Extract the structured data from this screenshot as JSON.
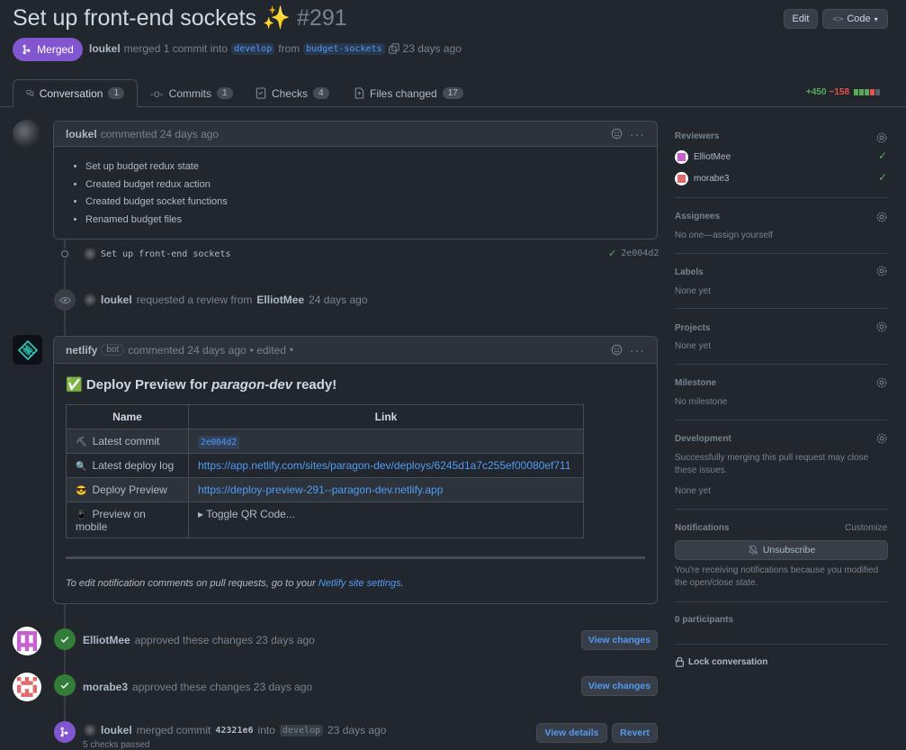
{
  "header": {
    "title": "Set up front-end sockets ✨",
    "number": "#291",
    "edit_label": "Edit",
    "code_label": "Code",
    "status_label": "Merged",
    "author": "loukel",
    "merged_text": "merged 1 commit into",
    "base_branch": "develop",
    "from_text": "from",
    "head_branch": "budget-sockets",
    "time": "23 days ago"
  },
  "tabs": [
    {
      "label": "Conversation",
      "count": "1"
    },
    {
      "label": "Commits",
      "count": "1"
    },
    {
      "label": "Checks",
      "count": "4"
    },
    {
      "label": "Files changed",
      "count": "17"
    }
  ],
  "diffstat": {
    "additions": "+450",
    "deletions": "−158"
  },
  "first_comment": {
    "author": "loukel",
    "meta": "commented 24 days ago",
    "items": [
      "Set up budget redux state",
      "Created budget redux action",
      "Created budget socket functions",
      "Renamed budget files"
    ]
  },
  "commit_event": {
    "message": "Set up front-end sockets",
    "sha": "2e004d2"
  },
  "review_request": {
    "author": "loukel",
    "text": "requested a review from",
    "reviewer": "ElliotMee",
    "time": "24 days ago"
  },
  "bot_comment": {
    "author": "netlify",
    "badge": "bot",
    "meta": "commented 24 days ago",
    "edited": "• edited",
    "heading_prefix": "✅ Deploy Preview for",
    "heading_site": "paragon-dev",
    "heading_suffix": "ready!",
    "table_headers": [
      "Name",
      "Link"
    ],
    "rows": [
      {
        "icon": "⛏",
        "name": "Latest commit",
        "value": "2e004d2"
      },
      {
        "icon": "🔍",
        "name": "Latest deploy log",
        "value": "https://app.netlify.com/sites/paragon-dev/deploys/6245d1a7c255ef00080ef711"
      },
      {
        "icon": "😎",
        "name": "Deploy Preview",
        "value": "https://deploy-preview-291--paragon-dev.netlify.app"
      },
      {
        "icon": "📱",
        "name": "Preview on mobile",
        "value": "▸  Toggle QR Code..."
      }
    ],
    "footer_prefix": "To edit notification comments on pull requests, go to your",
    "footer_link": "Netlify site settings",
    "footer_suffix": "."
  },
  "approvals": [
    {
      "user": "ElliotMee",
      "text": "approved these changes 23 days ago",
      "button": "View changes"
    },
    {
      "user": "morabe3",
      "text": "approved these changes 23 days ago",
      "button": "View changes"
    }
  ],
  "merge_event": {
    "author": "loukel",
    "text": "merged commit",
    "sha": "42321e6",
    "into": "into",
    "branch": "develop",
    "time": "23 days ago",
    "checks": "5 checks passed",
    "details_button": "View details",
    "revert_button": "Revert"
  },
  "sidebar": {
    "reviewers_title": "Reviewers",
    "reviewers": [
      "ElliotMee",
      "morabe3"
    ],
    "assignees_title": "Assignees",
    "assignees_value": "No one—assign yourself",
    "labels_title": "Labels",
    "labels_value": "None yet",
    "projects_title": "Projects",
    "projects_value": "None yet",
    "milestone_title": "Milestone",
    "milestone_value": "No milestone",
    "development_title": "Development",
    "development_text": "Successfully merging this pull request may close these issues.",
    "development_value": "None yet",
    "notifications_title": "Notifications",
    "customize_label": "Customize",
    "unsubscribe_label": "Unsubscribe",
    "notifications_text": "You're receiving notifications because you modified the open/close state.",
    "participants": "0 participants",
    "lock_label": "Lock conversation"
  },
  "colors": {
    "merged": "#8256d0",
    "approved": "#347d39",
    "link": "#539bf5"
  }
}
